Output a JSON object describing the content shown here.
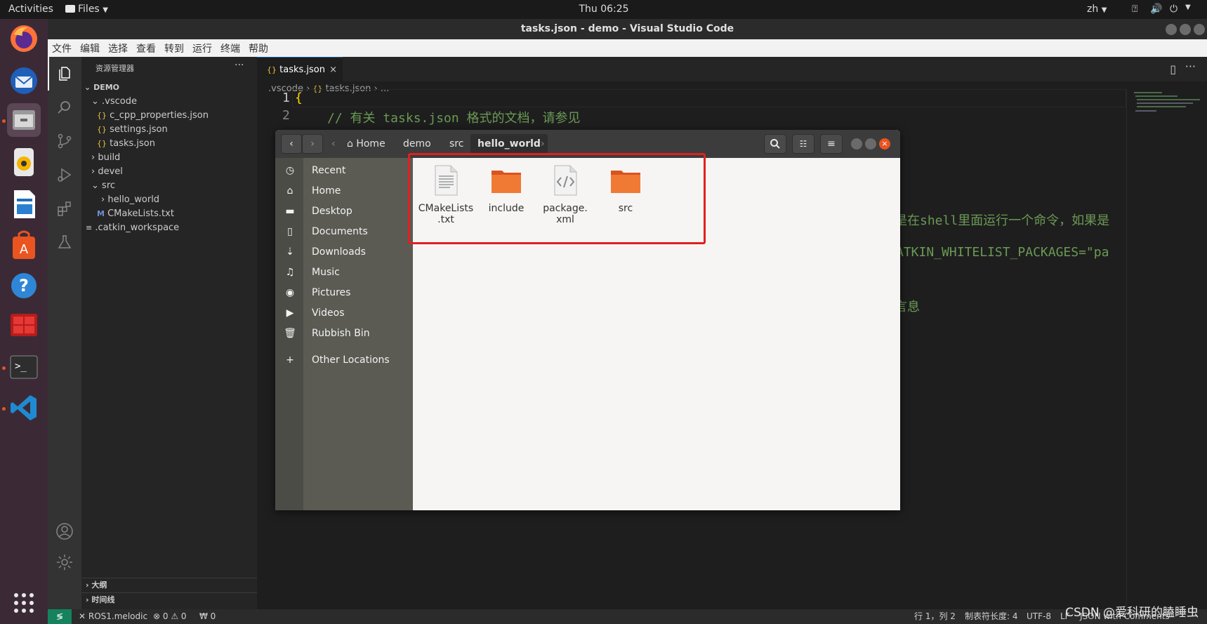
{
  "topbar": {
    "activities": "Activities",
    "app_menu": "Files",
    "clock": "Thu 06:25",
    "lang": "zh"
  },
  "window": {
    "title": "tasks.json - demo - Visual Studio Code"
  },
  "menubar": [
    "文件",
    "编辑",
    "选择",
    "查看",
    "转到",
    "运行",
    "终端",
    "帮助"
  ],
  "explorer": {
    "title": "资源管理器",
    "more": "···",
    "root": "DEMO",
    "items": [
      {
        "label": ".vscode",
        "kind": "folder-open"
      },
      {
        "label": "c_cpp_properties.json",
        "kind": "json"
      },
      {
        "label": "settings.json",
        "kind": "json"
      },
      {
        "label": "tasks.json",
        "kind": "json"
      },
      {
        "label": "build",
        "kind": "folder"
      },
      {
        "label": "devel",
        "kind": "folder"
      },
      {
        "label": "src",
        "kind": "folder-open"
      },
      {
        "label": "hello_world",
        "kind": "folder"
      },
      {
        "label": "CMakeLists.txt",
        "kind": "cmake"
      },
      {
        "label": ".catkin_workspace",
        "kind": "file"
      }
    ],
    "outline": "大纲",
    "timeline": "时间线"
  },
  "editor": {
    "tab": "tasks.json",
    "crumbs": [
      ".vscode",
      "tasks.json",
      "..."
    ],
    "line1_no": "1",
    "line2_no": "2",
    "line1": "{",
    "line2": "// 有关 tasks.json 格式的文档，请参见",
    "frag1": "是在shell里面运行一个命令，如果是",
    "frag2": "ATKIN_WHITELIST_PACKAGES=\"pa",
    "frag3": "言息"
  },
  "files": {
    "path": [
      "Home",
      "demo",
      "src",
      "hello_world"
    ],
    "sidebar": [
      "Recent",
      "Home",
      "Desktop",
      "Documents",
      "Downloads",
      "Music",
      "Pictures",
      "Videos",
      "Rubbish Bin",
      "Other Locations"
    ],
    "items": [
      {
        "name1": "CMakeLists",
        "name2": ".txt",
        "type": "text-file-icon"
      },
      {
        "name1": "include",
        "name2": "",
        "type": "folder-icon"
      },
      {
        "name1": "package.",
        "name2": "xml",
        "type": "xml-file-icon"
      },
      {
        "name1": "src",
        "name2": "",
        "type": "folder-icon"
      }
    ]
  },
  "status": {
    "remote": "ROS1.melodic",
    "problems": "⊗ 0 ⚠ 0",
    "ports": "₩ 0",
    "position": "行 1，列 2",
    "tabsize": "制表符长度: 4",
    "encoding": "UTF-8",
    "eol": "LF",
    "language": "JSON with Comments"
  },
  "watermark": "CSDN @爱科研的瞌睡虫",
  "colors": {
    "accent": "#e95420",
    "highlight_box": "#e02020",
    "vscode_blue": "#007acc"
  }
}
